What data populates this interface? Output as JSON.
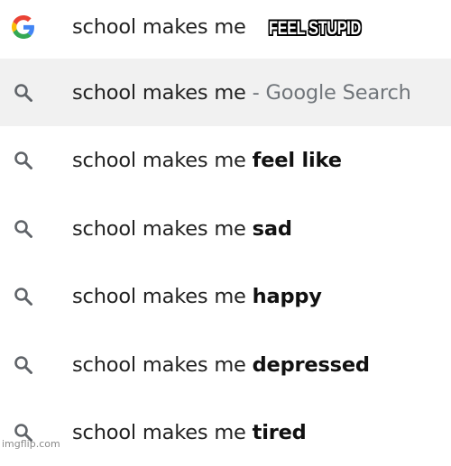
{
  "search": {
    "query": "school makes me"
  },
  "caption": "FEEL STUPID",
  "suggestions": [
    {
      "prefix": "school makes me",
      "bold": "",
      "suffix": "- Google Search",
      "icon": "search-icon"
    },
    {
      "prefix": "school makes me",
      "bold": "feel like",
      "suffix": "",
      "icon": "search-icon"
    },
    {
      "prefix": "school makes me",
      "bold": "sad",
      "suffix": "",
      "icon": "search-icon"
    },
    {
      "prefix": "school makes me",
      "bold": "happy",
      "suffix": "",
      "icon": "search-icon"
    },
    {
      "prefix": "school makes me",
      "bold": "depressed",
      "suffix": "",
      "icon": "search-icon"
    },
    {
      "prefix": "school makes me",
      "bold": "tired",
      "suffix": "",
      "icon": "search-icon"
    }
  ],
  "watermark": "imgflip.com",
  "colors": {
    "google_blue": "#4285F4",
    "google_red": "#EA4335",
    "google_yellow": "#FBBC05",
    "google_green": "#34A853",
    "highlight_row": "#f1f1f1",
    "suffix_gray": "#70757a"
  }
}
